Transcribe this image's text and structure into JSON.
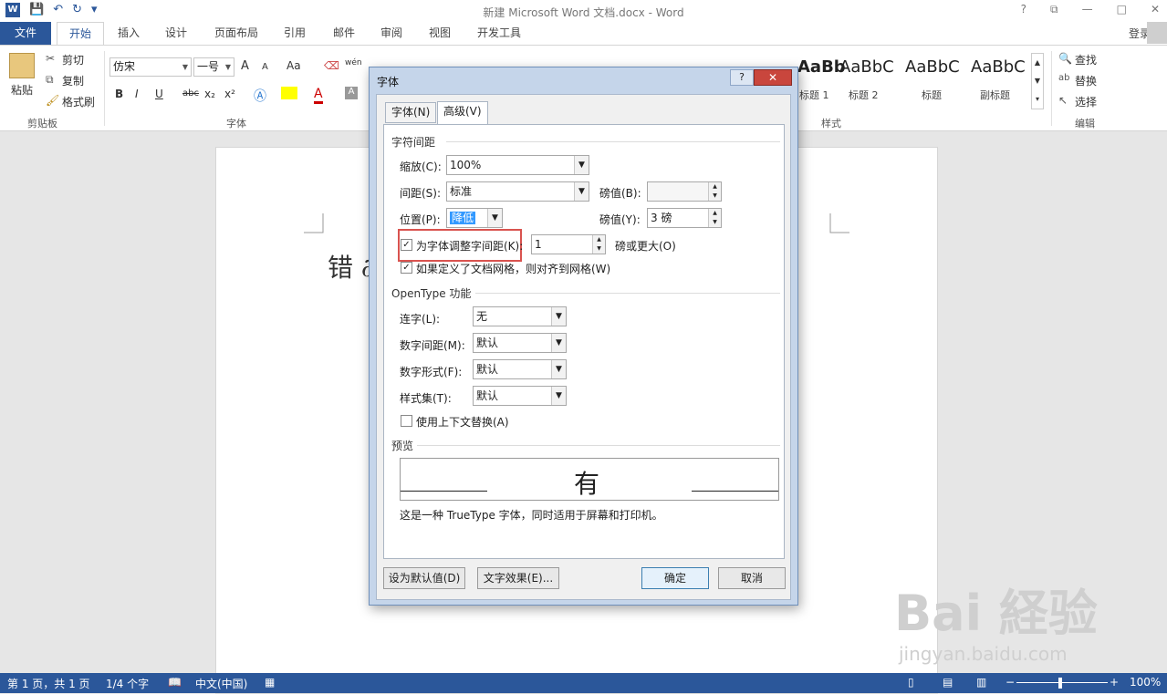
{
  "window": {
    "title": "新建 Microsoft Word 文档.docx - Word",
    "controls": [
      "?",
      "⧉",
      "—",
      "□",
      "✕"
    ]
  },
  "qat": {
    "app_icon": "W",
    "save": "💾",
    "undo": "↶",
    "redo": "↻",
    "more": "▾"
  },
  "menu": {
    "tabs": [
      "文件",
      "开始",
      "插入",
      "设计",
      "页面布局",
      "引用",
      "邮件",
      "审阅",
      "视图",
      "开发工具"
    ],
    "active": "开始",
    "login": "登录"
  },
  "ribbon": {
    "clipboard": {
      "paste": "粘贴",
      "cut": "剪切",
      "copy": "复制",
      "format_painter": "格式刷",
      "label": "剪贴板"
    },
    "font": {
      "name": "仿宋",
      "size": "一号",
      "grow": "A",
      "shrink": "A",
      "case": "Aa",
      "bold": "B",
      "italic": "I",
      "underline": "U",
      "strike": "abc",
      "sub": "x₂",
      "sup": "x²",
      "label": "字体",
      "font_color": "A"
    },
    "styles": {
      "items": [
        {
          "sample": "AaBb",
          "name": "标题 1"
        },
        {
          "sample": "AaBbC",
          "name": "标题 2"
        },
        {
          "sample": "AaBbC",
          "name": "标题"
        },
        {
          "sample": "AaBbC",
          "name": "副标题"
        }
      ],
      "label": "样式"
    },
    "editing": {
      "find": "查找",
      "replace": "替换",
      "select": "选择",
      "label": "编辑"
    }
  },
  "document": {
    "text": "错 ∂"
  },
  "dialog": {
    "title": "字体",
    "help": "?",
    "close": "✕",
    "tabs": [
      "字体(N)",
      "高级(V)"
    ],
    "active_tab": "高级(V)",
    "char_spacing": {
      "section": "字符间距",
      "scale_label": "缩放(C):",
      "scale_value": "100%",
      "spacing_label": "间距(S):",
      "spacing_value": "标准",
      "spacing_pt_label": "磅值(B):",
      "spacing_pt_value": "",
      "position_label": "位置(P):",
      "position_value": "降低",
      "position_pt_label": "磅值(Y):",
      "position_pt_value": "3 磅",
      "kerning_label": "为字体调整字间距(K):",
      "kerning_value": "1",
      "kerning_suffix": "磅或更大(O)",
      "grid_label": "如果定义了文档网格，则对齐到网格(W)"
    },
    "opentype": {
      "section": "OpenType 功能",
      "ligatures_label": "连字(L):",
      "ligatures_value": "无",
      "num_spacing_label": "数字间距(M):",
      "num_spacing_value": "默认",
      "num_forms_label": "数字形式(F):",
      "num_forms_value": "默认",
      "stylistic_label": "样式集(T):",
      "stylistic_value": "默认",
      "contextual_label": "使用上下文替换(A)"
    },
    "preview": {
      "section": "预览",
      "sample": "有",
      "note": "这是一种 TrueType 字体，同时适用于屏幕和打印机。"
    },
    "buttons": {
      "set_default": "设为默认值(D)",
      "text_effects": "文字效果(E)...",
      "ok": "确定",
      "cancel": "取消"
    }
  },
  "status": {
    "page": "第 1 页，共 1 页",
    "words": "1/4 个字",
    "lang": "中文(中国)",
    "zoom": "100%"
  },
  "watermark": {
    "main": "Bai 経验",
    "sub": "jingyan.baidu.com"
  }
}
